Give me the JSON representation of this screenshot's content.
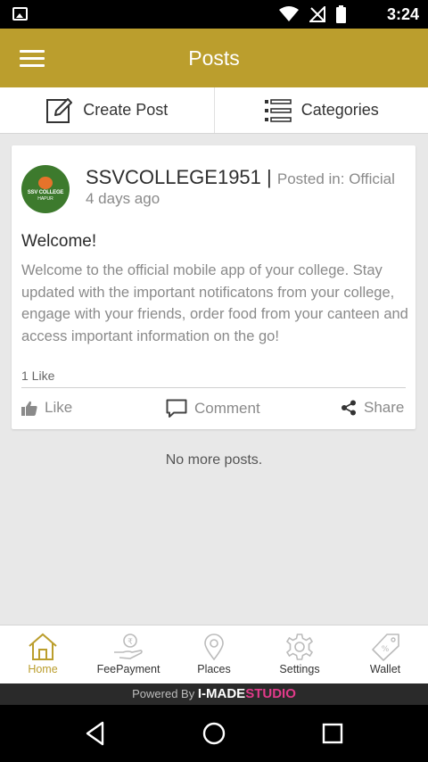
{
  "status_bar": {
    "time": "3:24"
  },
  "app_bar": {
    "title": "Posts"
  },
  "actions": {
    "create_post": "Create Post",
    "categories": "Categories"
  },
  "post": {
    "author": "SSVCOLLEGE1951",
    "separator": "|",
    "posted_in": "Posted in: Official",
    "time_ago": "4 days ago",
    "avatar_line1": "SSV COLLEGE",
    "avatar_line2": "HAPUR",
    "title": "Welcome!",
    "body": "Welcome to the official mobile app of your college. Stay updated with the important notificatons from your college, engage with your friends, order food from your canteen and access important information on the go!",
    "like_count": "1 Like",
    "like_label": "Like",
    "comment_label": "Comment",
    "share_label": "Share"
  },
  "no_more": "No more posts.",
  "bottom_nav": [
    {
      "label": "Home",
      "icon": "home-icon",
      "active": true
    },
    {
      "label": "FeePayment",
      "icon": "fee-payment-icon"
    },
    {
      "label": "Places",
      "icon": "map-pin-icon"
    },
    {
      "label": "Settings",
      "icon": "gear-icon"
    },
    {
      "label": "Wallet",
      "icon": "price-tag-icon"
    }
  ],
  "powered_by": {
    "prefix": "Powered By",
    "brand1": "I-MADE",
    "brand2": "STUDIO"
  },
  "colors": {
    "accent": "#bb9e2d",
    "background": "#e8e8e8"
  }
}
